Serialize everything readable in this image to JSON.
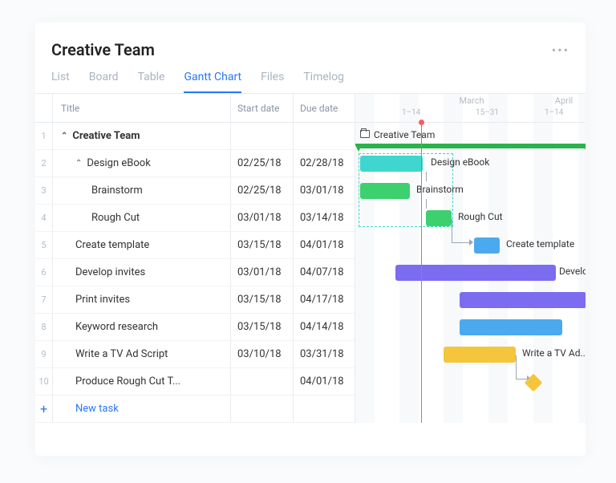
{
  "header": {
    "title": "Creative Team"
  },
  "tabs": [
    {
      "label": "List",
      "active": false
    },
    {
      "label": "Board",
      "active": false
    },
    {
      "label": "Table",
      "active": false
    },
    {
      "label": "Gantt Chart",
      "active": true
    },
    {
      "label": "Files",
      "active": false
    },
    {
      "label": "Timelog",
      "active": false
    }
  ],
  "columns": {
    "title": "Title",
    "start": "Start date",
    "due": "Due date"
  },
  "timeline": {
    "months": [
      {
        "label": "March",
        "ranges": [
          "1–14",
          "15–31"
        ]
      },
      {
        "label": "April",
        "ranges": [
          "1–14"
        ]
      }
    ]
  },
  "rows": [
    {
      "num": "1",
      "title": "Creative Team",
      "indent": 0,
      "caret": "open",
      "start": "",
      "due": ""
    },
    {
      "num": "2",
      "title": "Design eBook",
      "indent": 1,
      "caret": "open",
      "start": "02/25/18",
      "due": "02/28/18"
    },
    {
      "num": "3",
      "title": "Brainstorm",
      "indent": 2,
      "start": "02/25/18",
      "due": "03/01/18"
    },
    {
      "num": "4",
      "title": "Rough Cut",
      "indent": 2,
      "start": "03/01/18",
      "due": "03/14/18"
    },
    {
      "num": "5",
      "title": "Create template",
      "indent": 1,
      "start": "03/15/18",
      "due": "04/01/18"
    },
    {
      "num": "6",
      "title": "Develop invites",
      "indent": 1,
      "start": "03/01/18",
      "due": "04/07/18"
    },
    {
      "num": "7",
      "title": "Print invites",
      "indent": 1,
      "start": "03/15/18",
      "due": "04/17/18"
    },
    {
      "num": "8",
      "title": "Keyword research",
      "indent": 1,
      "start": "03/15/18",
      "due": "04/14/18"
    },
    {
      "num": "9",
      "title": "Write a TV Ad Script",
      "indent": 1,
      "start": "03/10/18",
      "due": "03/31/18"
    },
    {
      "num": "10",
      "title": "Produce Rough Cut T...",
      "indent": 1,
      "start": "",
      "due": "04/01/18"
    }
  ],
  "new_task_label": "New task",
  "gantt": {
    "folder_label": "Creative Team",
    "bars": {
      "design_ebook": "Design eBook",
      "brainstorm": "Brainstorm",
      "rough_cut": "Rough Cut",
      "create_template": "Create template",
      "develop": "Develop...",
      "write_tv": "Write a TV Ad..."
    }
  },
  "chart_data": {
    "type": "gantt",
    "title": "Creative Team — Gantt Chart",
    "x_axis": {
      "start": "2018-02-25",
      "end": "2018-04-17",
      "months": [
        "March",
        "April"
      ]
    },
    "today": "2018-03-05",
    "tasks": [
      {
        "name": "Creative Team",
        "type": "folder",
        "start": "2018-02-25",
        "end": "2018-04-17",
        "color": "#2cb24c"
      },
      {
        "name": "Design eBook",
        "type": "summary",
        "start": "2018-02-25",
        "end": "2018-02-28",
        "color": "#3fd6cf",
        "parent": "Creative Team"
      },
      {
        "name": "Brainstorm",
        "type": "task",
        "start": "2018-02-25",
        "end": "2018-03-01",
        "color": "#3cd06f",
        "parent": "Design eBook"
      },
      {
        "name": "Rough Cut",
        "type": "task",
        "start": "2018-03-01",
        "end": "2018-03-14",
        "color": "#3cd06f",
        "parent": "Design eBook",
        "depends_on": [
          "Brainstorm"
        ]
      },
      {
        "name": "Create template",
        "type": "task",
        "start": "2018-03-15",
        "end": "2018-04-01",
        "color": "#4ba9f0",
        "parent": "Creative Team",
        "depends_on": [
          "Rough Cut"
        ]
      },
      {
        "name": "Develop invites",
        "type": "task",
        "start": "2018-03-01",
        "end": "2018-04-07",
        "color": "#7b6cf0",
        "parent": "Creative Team"
      },
      {
        "name": "Print invites",
        "type": "task",
        "start": "2018-03-15",
        "end": "2018-04-17",
        "color": "#7b6cf0",
        "parent": "Creative Team"
      },
      {
        "name": "Keyword research",
        "type": "task",
        "start": "2018-03-15",
        "end": "2018-04-14",
        "color": "#4ba9f0",
        "parent": "Creative Team"
      },
      {
        "name": "Write a TV Ad Script",
        "type": "task",
        "start": "2018-03-10",
        "end": "2018-03-31",
        "color": "#f5c53c",
        "parent": "Creative Team"
      },
      {
        "name": "Produce Rough Cut T...",
        "type": "milestone",
        "date": "2018-04-01",
        "color": "#f5c53c",
        "parent": "Creative Team",
        "depends_on": [
          "Write a TV Ad Script"
        ]
      }
    ]
  }
}
